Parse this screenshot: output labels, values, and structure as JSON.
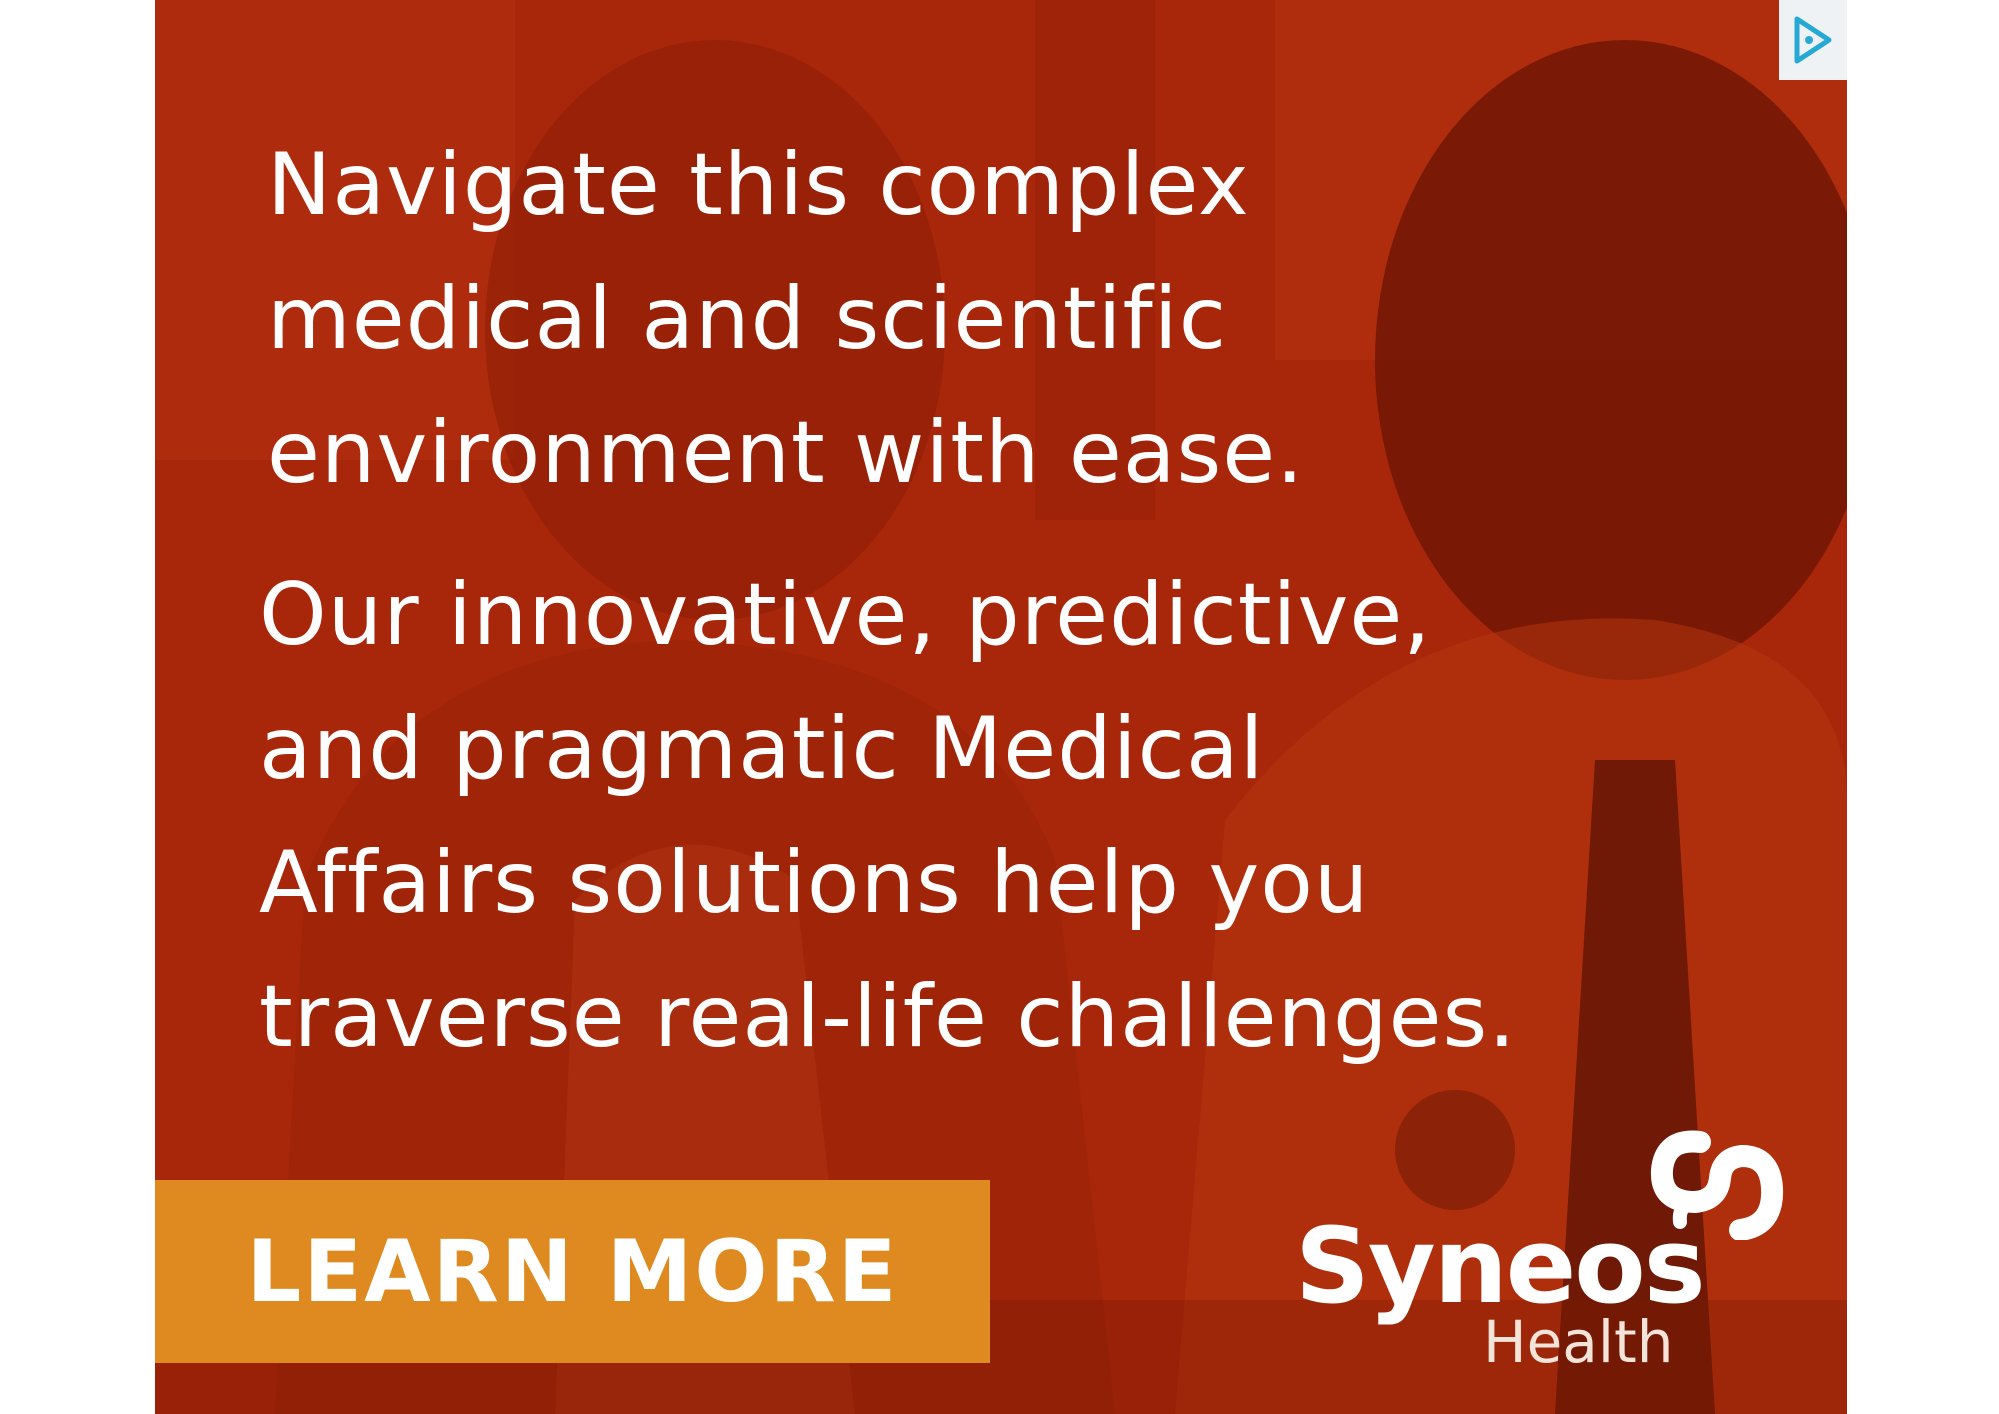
{
  "ad": {
    "headline_lines": [
      "Navigate this complex",
      "medical and scientific",
      "environment with ease."
    ],
    "body_lines": [
      "Our innovative, predictive,",
      "and pragmatic Medical",
      "Affairs solutions help you",
      "traverse real-life challenges."
    ],
    "cta_label": "LEARN MORE",
    "brand": {
      "name": "Syneos",
      "sub": "Health"
    },
    "colors": {
      "background": "#a8260a",
      "cta": "#de8a20",
      "text": "#ffffff"
    },
    "icons": [
      "adchoices-icon",
      "syneos-logo-mark"
    ]
  }
}
